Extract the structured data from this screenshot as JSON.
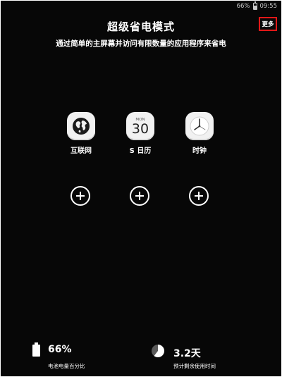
{
  "status_bar": {
    "battery_level": "66%",
    "time": "09:55"
  },
  "header": {
    "title": "超级省电模式",
    "subtitle": "通过简单的主屏幕并访问有限数量的应用程序来省电",
    "more_label": "更多"
  },
  "apps": [
    {
      "label": "互联网",
      "icon": "globe-icon"
    },
    {
      "label": "S 日历",
      "icon": "calendar-icon",
      "month": "MON",
      "day": "30"
    },
    {
      "label": "时钟",
      "icon": "clock-icon"
    }
  ],
  "add_slots": [
    {
      "icon": "plus-circle-icon"
    },
    {
      "icon": "plus-circle-icon"
    },
    {
      "icon": "plus-circle-icon"
    }
  ],
  "stats": {
    "battery": {
      "value": "66%",
      "caption": "电池电量百分比",
      "icon": "battery-icon",
      "level": 0.66
    },
    "remaining": {
      "value": "3.2天",
      "caption": "预计剩余使用时间",
      "icon": "pie-icon"
    }
  },
  "colors": {
    "background": "#070707",
    "text": "#ffffff",
    "highlight_border": "#e21818",
    "icon_tile": "#f1f1f1"
  }
}
